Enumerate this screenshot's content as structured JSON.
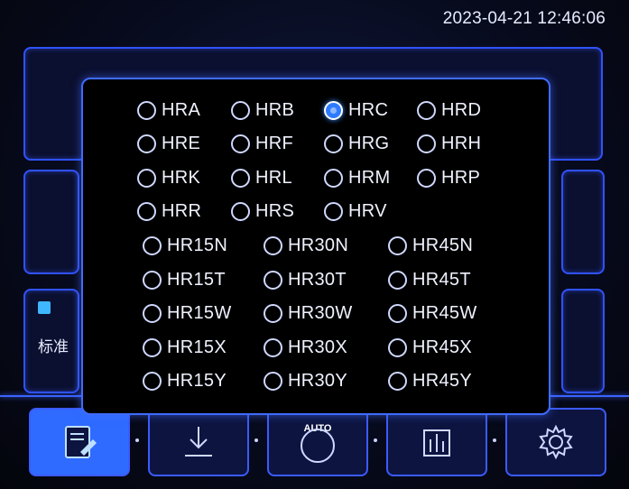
{
  "status_bar": {
    "datetime": "2023-04-21 12:46:06"
  },
  "background": {
    "left_label": "标准"
  },
  "toolbar": {
    "buttons": [
      {
        "name": "record",
        "icon": "edit-document-icon"
      },
      {
        "name": "download",
        "icon": "download-icon"
      },
      {
        "name": "auto",
        "icon": "auto-icon",
        "label": "AUTO"
      },
      {
        "name": "statistics",
        "icon": "bar-chart-icon"
      },
      {
        "name": "settings",
        "icon": "gear-icon"
      }
    ]
  },
  "scale_dialog": {
    "selected": "HRC",
    "rows": [
      [
        "HRA",
        "HRB",
        "HRC",
        "HRD"
      ],
      [
        "HRE",
        "HRF",
        "HRG",
        "HRH"
      ],
      [
        "HRK",
        "HRL",
        "HRM",
        "HRP"
      ],
      [
        "HRR",
        "HRS",
        "HRV"
      ],
      [
        "HR15N",
        "HR30N",
        "HR45N"
      ],
      [
        "HR15T",
        "HR30T",
        "HR45T"
      ],
      [
        "HR15W",
        "HR30W",
        "HR45W"
      ],
      [
        "HR15X",
        "HR30X",
        "HR45X"
      ],
      [
        "HR15Y",
        "HR30Y",
        "HR45Y"
      ]
    ]
  },
  "colors": {
    "accent": "#3b63ff",
    "selected": "#2f7bff",
    "text": "#f0f3ff"
  }
}
